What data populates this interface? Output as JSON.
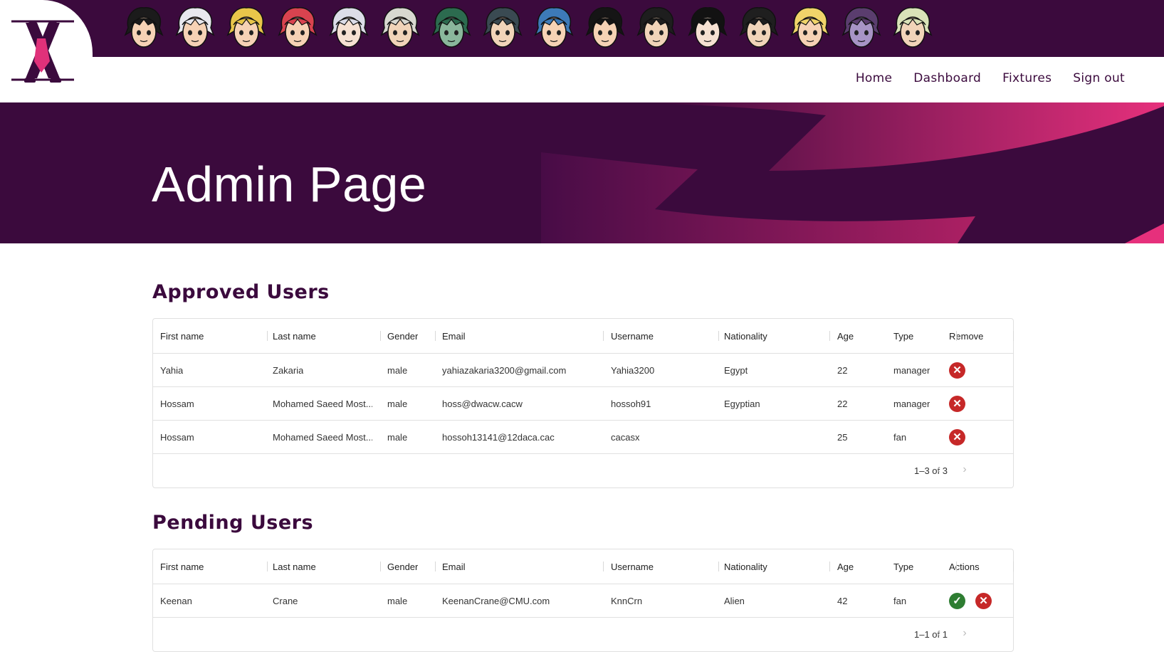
{
  "nav": {
    "links": [
      "Home",
      "Dashboard",
      "Fixtures",
      "Sign out"
    ]
  },
  "avatars": [
    {
      "name": "gon-avatar-icon",
      "hair": "#1b1b1b",
      "skin": "#f6d2b5"
    },
    {
      "name": "killua-avatar-icon",
      "hair": "#e8e8ee",
      "skin": "#f6d2b5"
    },
    {
      "name": "kurapika-avatar-icon",
      "hair": "#e8c64a",
      "skin": "#f6d2b5"
    },
    {
      "name": "hisoka-avatar-icon",
      "hair": "#d8434f",
      "skin": "#f6d2b5"
    },
    {
      "name": "neferpitou-avatar-icon",
      "hair": "#dcdde8",
      "skin": "#f6e1d2"
    },
    {
      "name": "netero-avatar-icon",
      "hair": "#d8d8d0",
      "skin": "#f1d4b9"
    },
    {
      "name": "meruem-avatar-icon",
      "hair": "#2c6b4f",
      "skin": "#8ab79c"
    },
    {
      "name": "ging-avatar-icon",
      "hair": "#3a4a52",
      "skin": "#f1d4b9"
    },
    {
      "name": "pariston-avatar-icon",
      "hair": "#3d7ab8",
      "skin": "#f6d2b5"
    },
    {
      "name": "chrollo-avatar-icon",
      "hair": "#151515",
      "skin": "#f6d2b5"
    },
    {
      "name": "feitan-avatar-icon",
      "hair": "#1e1e1e",
      "skin": "#f1d4b9"
    },
    {
      "name": "illumi-avatar-icon",
      "hair": "#121212",
      "skin": "#f6e1d2"
    },
    {
      "name": "leorio-avatar-icon",
      "hair": "#1f1f1f",
      "skin": "#f1d4b9"
    },
    {
      "name": "biscuit-avatar-icon",
      "hair": "#f0d46a",
      "skin": "#f6d2b5"
    },
    {
      "name": "gittarackur-avatar-icon",
      "hair": "#5a3d6e",
      "skin": "#a794c5"
    },
    {
      "name": "shaiapouf-avatar-icon",
      "hair": "#d9e2b8",
      "skin": "#f1d4b9"
    }
  ],
  "hero": {
    "title": "Admin Page"
  },
  "approved": {
    "title": "Approved Users",
    "columns": [
      "First name",
      "Last name",
      "Gender",
      "Email",
      "Username",
      "Nationality",
      "Age",
      "Type",
      "Remove"
    ],
    "rows": [
      [
        "Yahia",
        "Zakaria",
        "male",
        "yahiazakaria3200@gmail.com",
        "Yahia3200",
        "Egypt",
        "22",
        "manager"
      ],
      [
        "Hossam",
        "Mohamed Saeed Most...",
        "male",
        "hoss@dwacw.cacw",
        "hossoh91",
        "Egyptian",
        "22",
        "manager"
      ],
      [
        "Hossam",
        "Mohamed Saeed Most...",
        "male",
        "hossoh13141@12daca.cac",
        "cacasx",
        "",
        "25",
        "fan"
      ]
    ],
    "pagination": "1–3 of 3"
  },
  "pending": {
    "title": "Pending Users",
    "columns": [
      "First name",
      "Last name",
      "Gender",
      "Email",
      "Username",
      "Nationality",
      "Age",
      "Type",
      "Actions"
    ],
    "rows": [
      [
        "Keenan",
        "Crane",
        "male",
        "KeenanCrane@CMU.com",
        "KnnCrn",
        "Alien",
        "42",
        "fan"
      ]
    ],
    "pagination": "1–1 of 1"
  },
  "colors": {
    "brand": "#3b0a3d",
    "accent": "#e0317a",
    "remove": "#c62828",
    "approve": "#2e7d32"
  }
}
